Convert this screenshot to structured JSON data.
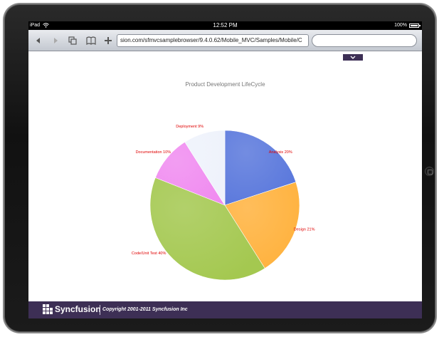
{
  "statusbar": {
    "device": "iPad",
    "time": "12:52 PM",
    "battery": "100%",
    "icons": [
      "wifi-icon",
      "battery-icon"
    ]
  },
  "browser": {
    "url": "sion.com/sfmvcsamplebrowser/9.4.0.62/Mobile_MVC/Samples/Mobile/C",
    "search_placeholder": "",
    "buttons": [
      "back-icon",
      "forward-icon",
      "pages-icon",
      "bookmarks-icon",
      "add-icon"
    ]
  },
  "chart_data": {
    "type": "pie",
    "title": "Product Development LifeCycle",
    "slices": [
      {
        "label": "Analysis 20%",
        "name": "Analysis",
        "value": 20,
        "color": "#5a78dc"
      },
      {
        "label": "Design 21%",
        "name": "Design",
        "value": 21,
        "color": "#ffb23e"
      },
      {
        "label": "Code/Unit Test 40%",
        "name": "Code/Unit Test",
        "value": 40,
        "color": "#a4c850"
      },
      {
        "label": "Documentation 10%",
        "name": "Documentation",
        "value": 10,
        "color": "#f08cf0"
      },
      {
        "label": "Deployment 9%",
        "name": "Deployment",
        "value": 9,
        "color": "#eef2fb"
      }
    ],
    "label_color": "#e00000"
  },
  "footer": {
    "logo": "Syncfusion",
    "copyright": "Copyright 2001-2011 Syncfusion Inc",
    "background": "#3d2f55"
  }
}
